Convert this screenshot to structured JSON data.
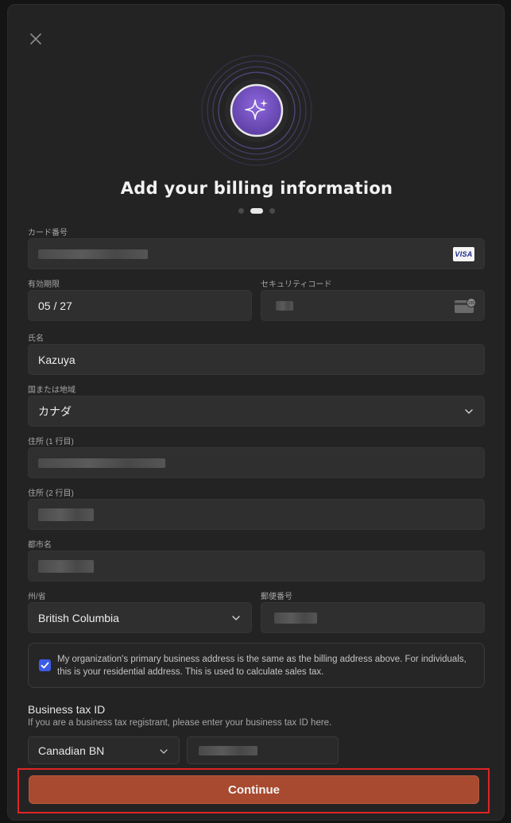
{
  "modal": {
    "title": "Add your billing information",
    "steps": {
      "total": 3,
      "current": 2
    }
  },
  "icons": {
    "close": "close-icon",
    "sparkle": "sparkle-icon",
    "card_brand": "visa-icon",
    "cvc": "card-cvc-icon",
    "chevron": "chevron-down-icon",
    "checkbox": "checkmark-icon"
  },
  "card": {
    "label": "カード番号",
    "brand_text": "VISA"
  },
  "expiry": {
    "label": "有効期限",
    "value": "05 / 27"
  },
  "security": {
    "label": "セキュリティコード",
    "badge": "135"
  },
  "name": {
    "label": "氏名",
    "value": "Kazuya"
  },
  "country": {
    "label": "国または地域",
    "value": "カナダ"
  },
  "address1": {
    "label": "住所 (1 行目)"
  },
  "address2": {
    "label": "住所 (2 行目)"
  },
  "city": {
    "label": "都市名"
  },
  "state": {
    "label": "州/省",
    "value": "British Columbia"
  },
  "postal": {
    "label": "郵便番号"
  },
  "notice": {
    "checked": true,
    "text": "My organization's primary business address is the same as the billing address above. For individuals, this is your residential address. This is used to calculate sales tax."
  },
  "tax": {
    "title": "Business tax ID",
    "subtitle": "If you are a business tax registrant, please enter your business tax ID here.",
    "type_value": "Canadian BN"
  },
  "actions": {
    "continue_label": "Continue"
  },
  "colors": {
    "accent_button": "#a84a2f",
    "checkbox": "#3b5be8",
    "hero_purple": "#7b57c9",
    "highlight_border": "#e02424"
  }
}
